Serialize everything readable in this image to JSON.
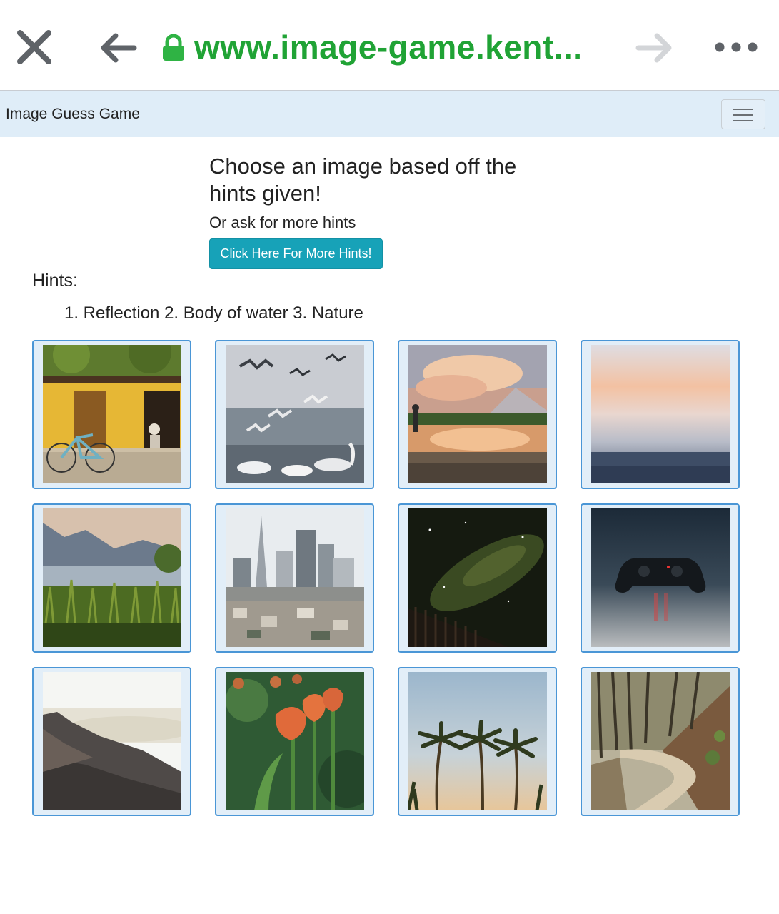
{
  "browser": {
    "url": "www.image-game.kent...",
    "close_icon": "close-icon",
    "back_icon": "back-arrow-icon",
    "lock_icon": "lock-icon",
    "forward_icon": "forward-arrow-icon",
    "more_icon": "more-dots-icon",
    "url_color": "#20a335"
  },
  "navbar": {
    "brand": "Image Guess Game",
    "menu_icon": "hamburger-menu-icon",
    "background": "#dfedf8"
  },
  "main": {
    "heading": "Choose an image based off the hints given!",
    "subheading": "Or ask for more hints",
    "more_hints_button": "Click Here For More Hints!",
    "button_color": "#17a2b8",
    "hints_label": "Hints:",
    "hints_text": "1. Reflection 2. Body of water 3. Nature"
  },
  "images": [
    {
      "subject": "yellow-house-bicycle"
    },
    {
      "subject": "seagulls-swans-water"
    },
    {
      "subject": "mountain-lake-sunset-reflection"
    },
    {
      "subject": "misty-sea-sunrise"
    },
    {
      "subject": "lake-reeds-mountains"
    },
    {
      "subject": "city-skyline"
    },
    {
      "subject": "night-sky-milky-way"
    },
    {
      "subject": "game-controller"
    },
    {
      "subject": "mountain-above-clouds"
    },
    {
      "subject": "orange-tulips"
    },
    {
      "subject": "palm-trees"
    },
    {
      "subject": "forest-dirt-road"
    }
  ]
}
